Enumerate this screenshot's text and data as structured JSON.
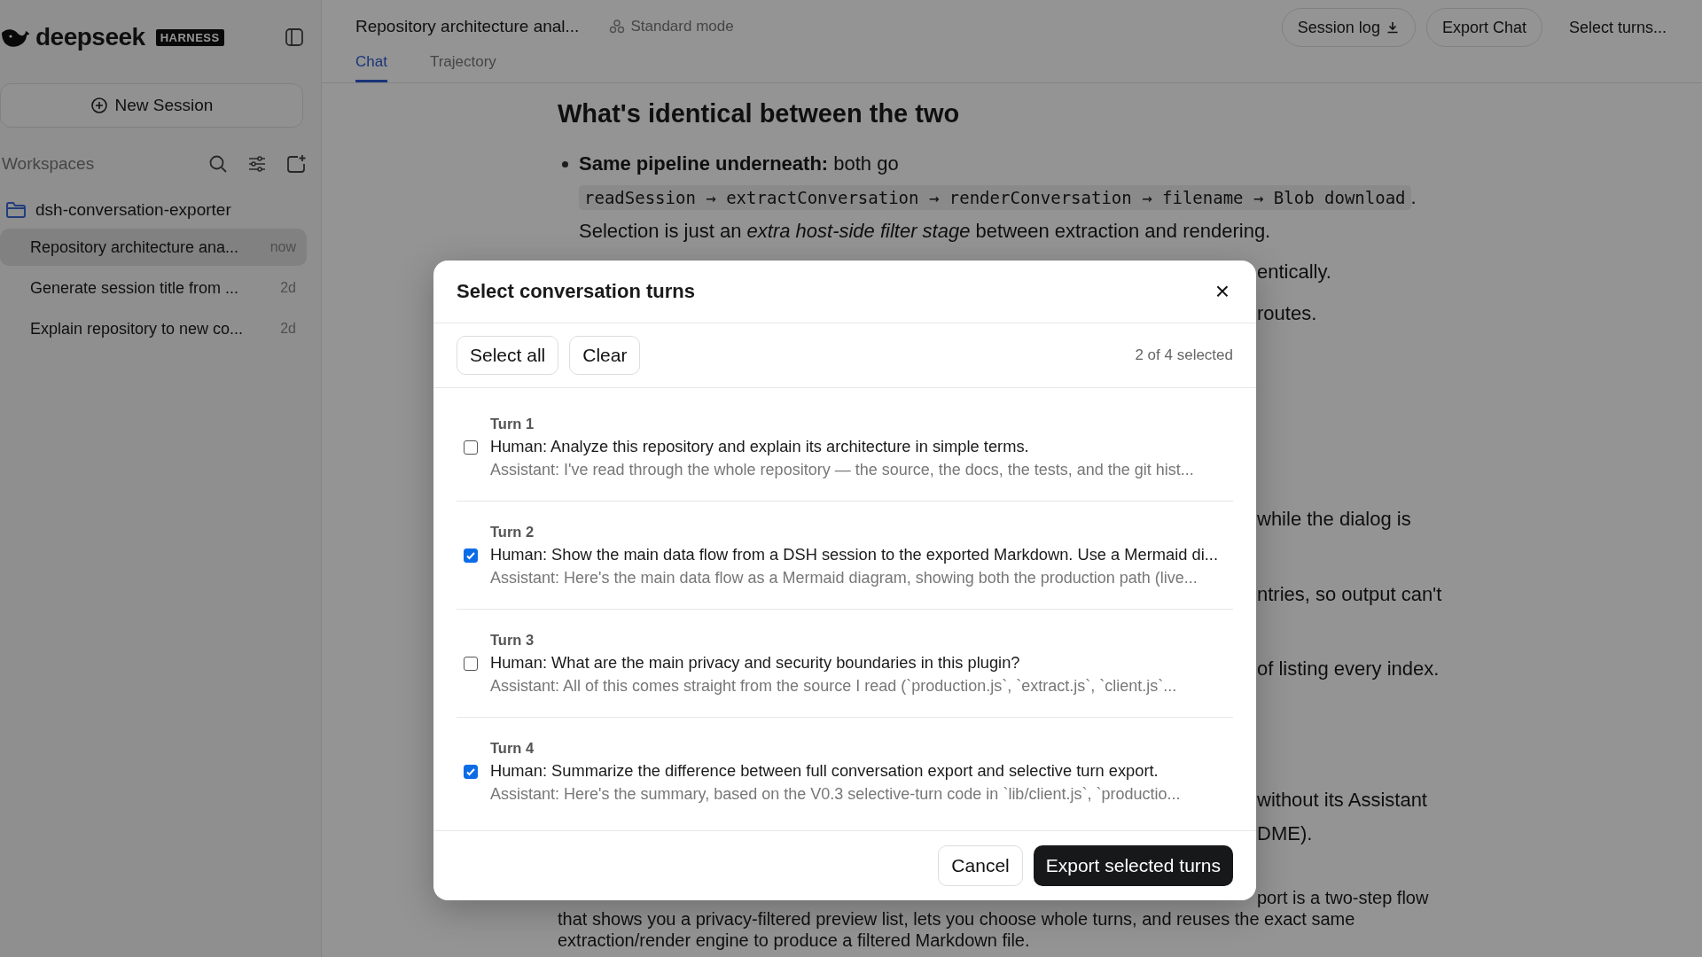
{
  "sidebar": {
    "logo_text": "deepseek",
    "badge": "HARNESS",
    "new_session": "New Session",
    "workspaces_label": "Workspaces",
    "workspace": {
      "name": "dsh-conversation-exporter",
      "sessions": [
        {
          "title": "Repository architecture ana...",
          "age": "now",
          "selected": true
        },
        {
          "title": "Generate session title from ...",
          "age": "2d",
          "selected": false
        },
        {
          "title": "Explain repository to new co...",
          "age": "2d",
          "selected": false
        }
      ]
    }
  },
  "header": {
    "title": "Repository architecture anal...",
    "mode": "Standard mode",
    "buttons": [
      {
        "label": "Session log",
        "kind": "download"
      },
      {
        "label": "Export Chat",
        "kind": "outlined"
      },
      {
        "label": "Select turns...",
        "kind": "plain"
      }
    ],
    "tabs": [
      {
        "label": "Chat",
        "selected": true
      },
      {
        "label": "Trajectory",
        "selected": false
      }
    ]
  },
  "content": {
    "heading": "What's identical between the two",
    "bullet": {
      "lead": "**Same pipeline underneath:** both go",
      "code": "readSession → extractConversation → renderConversation → filename → Blob download",
      "after": ".",
      "text": "Selection is just an *extra host-side filter stage* between extraction and rendering."
    },
    "fragments": [
      [
        "entically."
      ],
      [
        "routes."
      ],
      [
        "while the dialog is"
      ],
      [
        "ntries, so output can't"
      ],
      [
        "of listing every index."
      ],
      [
        "without its Assistant",
        "DME)."
      ],
      [
        "port is a two-step flow",
        "that shows you a privacy-filtered preview list, lets you choose whole turns, and reuses the exact same",
        "extraction/render engine to produce a filtered Markdown file."
      ]
    ]
  },
  "dialog": {
    "title": "Select conversation turns",
    "close": "×",
    "select_all": "Select all",
    "clear": "Clear",
    "count": "2 of 4 selected",
    "turns": [
      {
        "label": "Turn 1",
        "human": "Human: Analyze this repository and explain its architecture in simple terms.",
        "assistant": "Assistant: I've read through the whole repository — the source, the docs, the tests, and the git hist...",
        "selected": false
      },
      {
        "label": "Turn 2",
        "human": "Human: Show the main data flow from a DSH session to the exported Markdown. Use a Mermaid di...",
        "assistant": "Assistant: Here's the main data flow as a Mermaid diagram, showing both the production path (live...",
        "selected": true
      },
      {
        "label": "Turn 3",
        "human": "Human: What are the main privacy and security boundaries in this plugin?",
        "assistant": "Assistant: All of this comes straight from the source I read (`production.js`, `extract.js`, `client.js`...",
        "selected": false
      },
      {
        "label": "Turn 4",
        "human": "Human: Summarize the difference between full conversation export and selective turn export.",
        "assistant": "Assistant: Here's the summary, based on the V0.3 selective-turn code in `lib/client.js`, `productio...",
        "selected": true
      }
    ],
    "cancel": "Cancel",
    "export": "Export selected turns"
  }
}
